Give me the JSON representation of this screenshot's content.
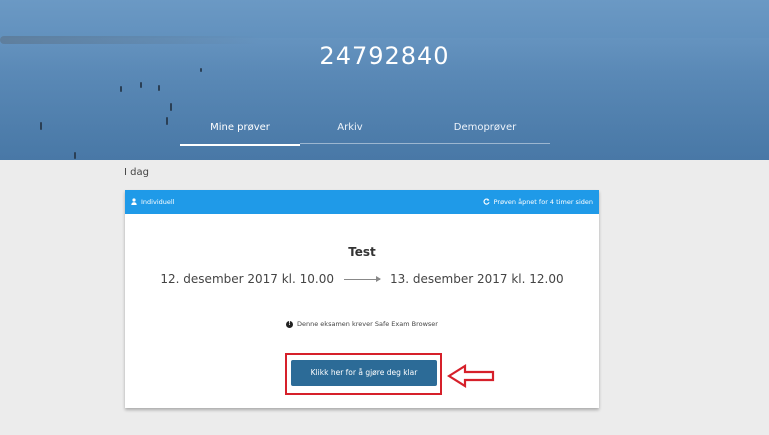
{
  "header": {
    "title": "24792840",
    "tabs": [
      {
        "label": "Mine prøver",
        "active": true
      },
      {
        "label": "Arkiv",
        "active": false
      },
      {
        "label": "Demoprøver",
        "active": false
      }
    ]
  },
  "section": {
    "label": "I dag"
  },
  "exam_card": {
    "type_label": "Individuell",
    "status_label": "Prøven åpnet for 4 timer siden",
    "name": "Test",
    "start": "12. desember 2017 kl. 10.00",
    "end": "13. desember 2017 kl. 12.00",
    "notice": "Denne eksamen krever Safe Exam Browser",
    "notice_icon": "!",
    "ready_button": "Klikk her for å gjøre deg klar"
  },
  "colors": {
    "header_bar": "#1f9ae8",
    "button": "#2c6b97",
    "highlight": "#d6202a"
  }
}
